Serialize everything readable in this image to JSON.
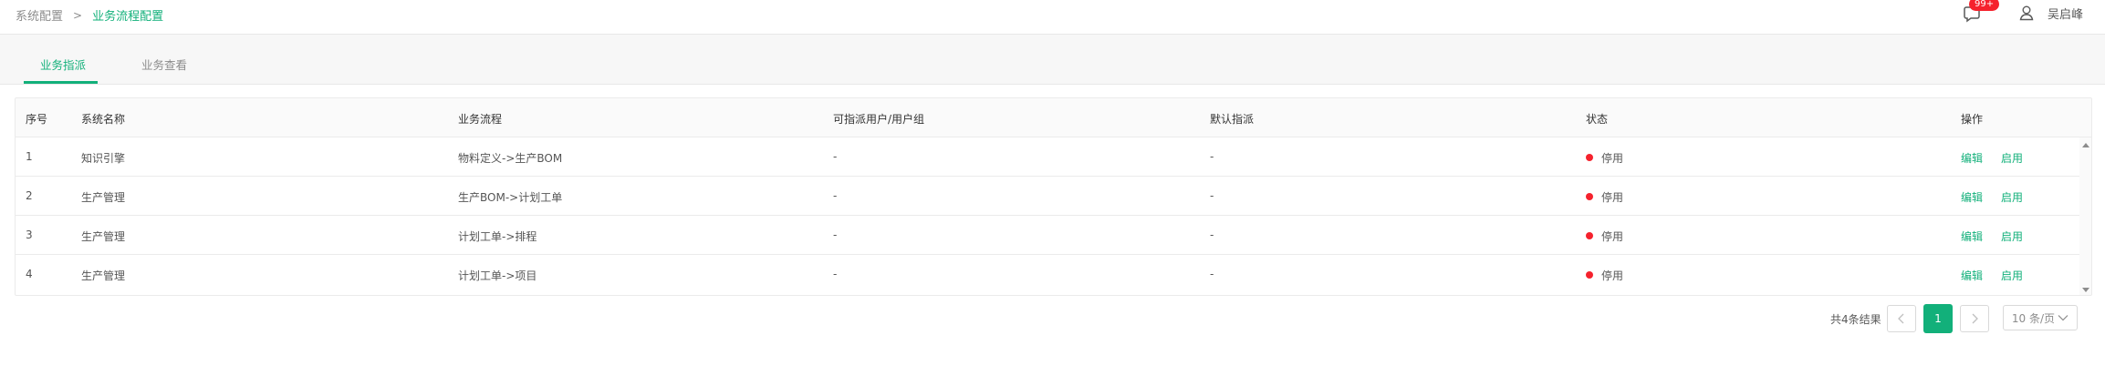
{
  "breadcrumb": {
    "parent": "系统配置",
    "separator": ">",
    "current": "业务流程配置"
  },
  "header": {
    "notification_badge": "99+",
    "user_name": "吴启峰"
  },
  "tabs": [
    {
      "label": "业务指派",
      "active": true
    },
    {
      "label": "业务查看",
      "active": false
    }
  ],
  "table": {
    "columns": [
      "序号",
      "系统名称",
      "业务流程",
      "可指派用户/用户组",
      "默认指派",
      "状态",
      "操作"
    ],
    "rows": [
      {
        "index": "1",
        "system": "知识引擎",
        "flow": "物料定义->生产BOM",
        "assignable": "-",
        "default": "-",
        "status": "停用",
        "action_edit": "编辑",
        "action_enable": "启用"
      },
      {
        "index": "2",
        "system": "生产管理",
        "flow": "生产BOM->计划工单",
        "assignable": "-",
        "default": "-",
        "status": "停用",
        "action_edit": "编辑",
        "action_enable": "启用"
      },
      {
        "index": "3",
        "system": "生产管理",
        "flow": "计划工单->排程",
        "assignable": "-",
        "default": "-",
        "status": "停用",
        "action_edit": "编辑",
        "action_enable": "启用"
      },
      {
        "index": "4",
        "system": "生产管理",
        "flow": "计划工单->项目",
        "assignable": "-",
        "default": "-",
        "status": "停用",
        "action_edit": "编辑",
        "action_enable": "启用"
      }
    ]
  },
  "pagination": {
    "total_text": "共4条结果",
    "current_page": "1",
    "page_size": "10 条/页"
  },
  "colors": {
    "accent": "#12b07a",
    "status_disabled": "#f5222d",
    "badge": "#f5222d"
  },
  "icons": {
    "bell": "message-bell-icon",
    "user": "user-icon",
    "prev": "chevron-left-icon",
    "next": "chevron-right-icon",
    "dropdown": "chevron-down-icon"
  }
}
